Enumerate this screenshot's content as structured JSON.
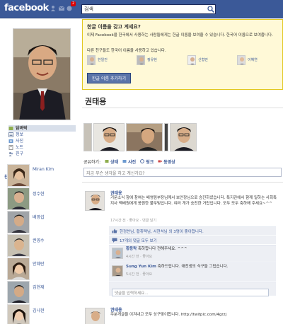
{
  "topbar": {
    "logo": "facebook",
    "notif_count": "2",
    "search_value": "검색"
  },
  "left": {
    "nav": [
      {
        "label": "담벼락",
        "icon": "wall-icon"
      },
      {
        "label": "정보",
        "icon": "info-icon"
      },
      {
        "label": "사진",
        "icon": "photos-icon"
      },
      {
        "label": "노트",
        "icon": "notes-icon"
      },
      {
        "label": "친구",
        "icon": "friends-icon"
      }
    ],
    "friends_title": "친구 (174)",
    "friends": [
      "Miran Kim",
      "정수현",
      "배영섭",
      "권영수",
      "안혜란",
      "김현재",
      "김나현"
    ]
  },
  "promo": {
    "title": "한글 이름을 갖고 계세요?",
    "body": "이제 Facebook을 한국에서 사용하는 사람들에게는 한글 이름을 보여줄 수 있습니다. 한국어 이름으로 보여줍니다.",
    "sub": "다른 친구들도 한국어 이름을 사용하고 있습니다.",
    "people": [
      "한일진",
      "정유현",
      "신형민",
      "이혜연"
    ],
    "button": "한글 이름 추가하기"
  },
  "profile": {
    "name": "권태용"
  },
  "share": {
    "label": "공유하기:",
    "options": [
      "상태",
      "사진",
      "링크",
      "동영상"
    ],
    "placeholder": "지금 무슨 생각을 하고 계신가요?"
  },
  "post1": {
    "author": "권태용",
    "text": "거문소식 항에 참여는 배영림부장님께서 보안장님으로 승진하셨습니다. 특지관에서 함께 일하는 사회특지사 백배원에게 응원한 불무빛입니다. 여러 개가 승진한 거랍입니다. 모두 모두 축하해 주세요~^^",
    "meta": "17시간 전 · 좋아요 · 댓글 달기",
    "likes": "한정찬님, 황휴택님, 서현석님 외 3명이 좋아합니다.",
    "view_comments": "17개의 댓글 모두 보기",
    "comments": [
      {
        "author": "황용락",
        "text": "축하합니다 전해주세요. ^^^",
        "meta": "4시간 전 · 좋아요"
      },
      {
        "author": "Sung Yun Kim",
        "text": "축하드립니다. 애전생의 식구들 그립습니다.",
        "meta": "5시간 전 · 좋아요"
      }
    ],
    "comment_placeholder": "댓글을 입력하세요..."
  },
  "post2": {
    "author": "권태용",
    "text": "주분게글을 이겨내고 모두 상구맞이합니다. http://twitpic.com/4grzj"
  },
  "colors": {
    "brand": "#3b5998",
    "promo_bg": "#fff9d7",
    "ufi_bg": "#edeff4"
  }
}
